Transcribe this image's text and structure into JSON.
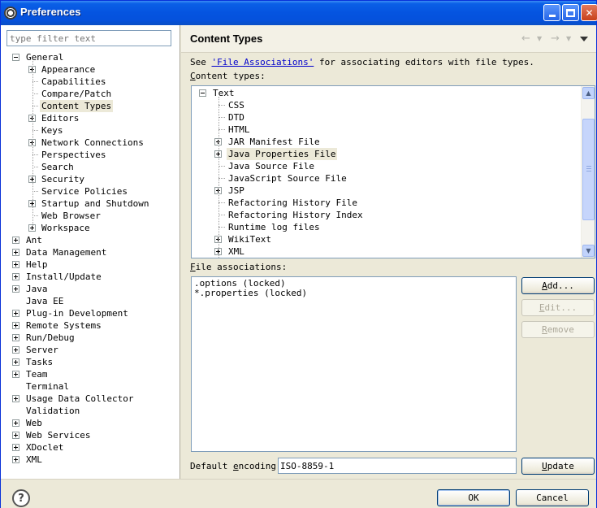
{
  "window": {
    "title": "Preferences"
  },
  "filter": {
    "placeholder": "type filter text"
  },
  "nav_tree": [
    {
      "label": "General",
      "depth": 0,
      "expander": "minus"
    },
    {
      "label": "Appearance",
      "depth": 1,
      "expander": "plus"
    },
    {
      "label": "Capabilities",
      "depth": 1,
      "expander": "none"
    },
    {
      "label": "Compare/Patch",
      "depth": 1,
      "expander": "none"
    },
    {
      "label": "Content Types",
      "depth": 1,
      "expander": "none",
      "selected": true
    },
    {
      "label": "Editors",
      "depth": 1,
      "expander": "plus"
    },
    {
      "label": "Keys",
      "depth": 1,
      "expander": "none"
    },
    {
      "label": "Network Connections",
      "depth": 1,
      "expander": "plus"
    },
    {
      "label": "Perspectives",
      "depth": 1,
      "expander": "none"
    },
    {
      "label": "Search",
      "depth": 1,
      "expander": "none"
    },
    {
      "label": "Security",
      "depth": 1,
      "expander": "plus"
    },
    {
      "label": "Service Policies",
      "depth": 1,
      "expander": "none"
    },
    {
      "label": "Startup and Shutdown",
      "depth": 1,
      "expander": "plus"
    },
    {
      "label": "Web Browser",
      "depth": 1,
      "expander": "none"
    },
    {
      "label": "Workspace",
      "depth": 1,
      "expander": "plus"
    },
    {
      "label": "Ant",
      "depth": 0,
      "expander": "plus"
    },
    {
      "label": "Data Management",
      "depth": 0,
      "expander": "plus"
    },
    {
      "label": "Help",
      "depth": 0,
      "expander": "plus"
    },
    {
      "label": "Install/Update",
      "depth": 0,
      "expander": "plus"
    },
    {
      "label": "Java",
      "depth": 0,
      "expander": "plus"
    },
    {
      "label": "Java EE",
      "depth": 0,
      "expander": "none"
    },
    {
      "label": "Plug-in Development",
      "depth": 0,
      "expander": "plus"
    },
    {
      "label": "Remote Systems",
      "depth": 0,
      "expander": "plus"
    },
    {
      "label": "Run/Debug",
      "depth": 0,
      "expander": "plus"
    },
    {
      "label": "Server",
      "depth": 0,
      "expander": "plus"
    },
    {
      "label": "Tasks",
      "depth": 0,
      "expander": "plus"
    },
    {
      "label": "Team",
      "depth": 0,
      "expander": "plus"
    },
    {
      "label": "Terminal",
      "depth": 0,
      "expander": "none"
    },
    {
      "label": "Usage Data Collector",
      "depth": 0,
      "expander": "plus"
    },
    {
      "label": "Validation",
      "depth": 0,
      "expander": "none"
    },
    {
      "label": "Web",
      "depth": 0,
      "expander": "plus"
    },
    {
      "label": "Web Services",
      "depth": 0,
      "expander": "plus"
    },
    {
      "label": "XDoclet",
      "depth": 0,
      "expander": "plus"
    },
    {
      "label": "XML",
      "depth": 0,
      "expander": "plus"
    }
  ],
  "page": {
    "title": "Content Types",
    "see_prefix": "See ",
    "see_link": "'File Associations'",
    "see_suffix": " for associating editors with file types.",
    "content_types_label_mnemonic": "C",
    "content_types_label_rest": "ontent types:",
    "file_assoc_label_mnemonic": "F",
    "file_assoc_label_rest": "ile associations:",
    "encoding_label_prefix": "Default ",
    "encoding_label_mnemonic": "e",
    "encoding_label_rest": "ncoding:",
    "encoding_value": "ISO-8859-1"
  },
  "content_tree": [
    {
      "label": "Text",
      "depth": 0,
      "expander": "minus"
    },
    {
      "label": "CSS",
      "depth": 1,
      "expander": "none"
    },
    {
      "label": "DTD",
      "depth": 1,
      "expander": "none"
    },
    {
      "label": "HTML",
      "depth": 1,
      "expander": "none"
    },
    {
      "label": "JAR Manifest File",
      "depth": 1,
      "expander": "plus"
    },
    {
      "label": "Java Properties File",
      "depth": 1,
      "expander": "plus",
      "selected": true
    },
    {
      "label": "Java Source File",
      "depth": 1,
      "expander": "none"
    },
    {
      "label": "JavaScript Source File",
      "depth": 1,
      "expander": "none"
    },
    {
      "label": "JSP",
      "depth": 1,
      "expander": "plus"
    },
    {
      "label": "Refactoring History File",
      "depth": 1,
      "expander": "none"
    },
    {
      "label": "Refactoring History Index",
      "depth": 1,
      "expander": "none"
    },
    {
      "label": "Runtime log files",
      "depth": 1,
      "expander": "none"
    },
    {
      "label": "WikiText",
      "depth": 1,
      "expander": "plus"
    },
    {
      "label": "XML",
      "depth": 1,
      "expander": "plus"
    }
  ],
  "file_associations": [
    ".options (locked)",
    "*.properties (locked)"
  ],
  "buttons": {
    "add_mnemonic": "A",
    "add_rest": "dd...",
    "edit_mnemonic": "E",
    "edit_rest": "dit...",
    "remove_mnemonic": "R",
    "remove_rest": "emove",
    "update_mnemonic": "U",
    "update_rest": "pdate",
    "ok": "OK",
    "cancel": "Cancel"
  },
  "icons": {
    "back": "←",
    "forward": "→",
    "menu_arrow": "▼",
    "help": "?"
  }
}
